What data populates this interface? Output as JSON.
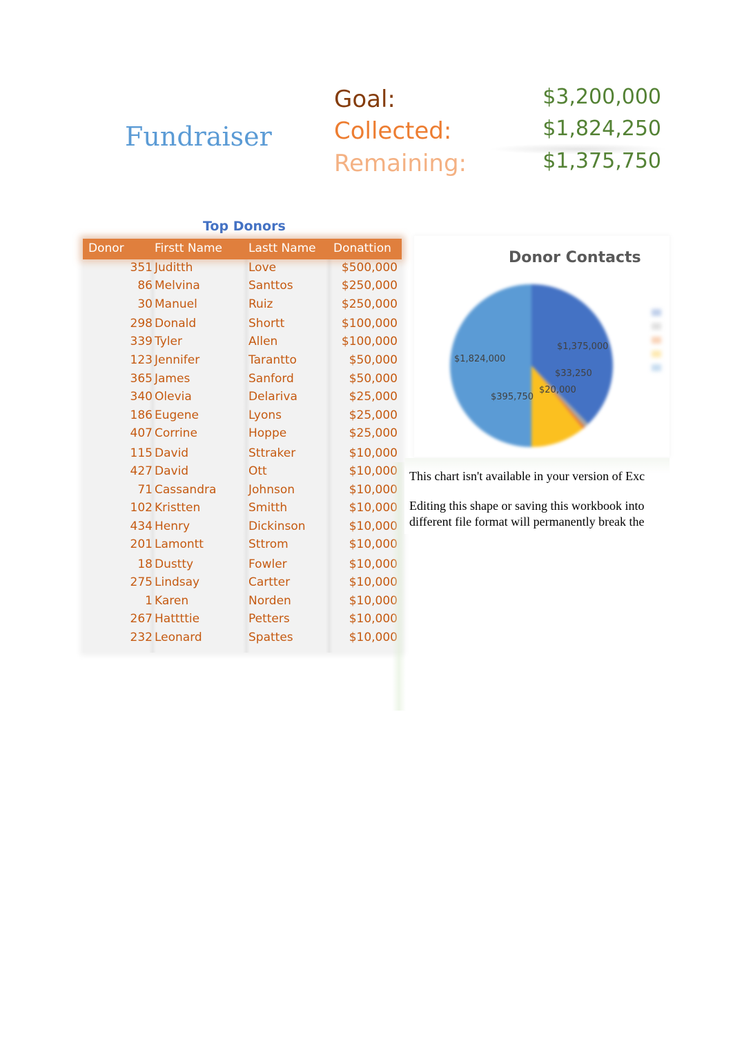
{
  "header": {
    "title": "Fundraiser",
    "summary": [
      {
        "label": "Goal:",
        "value": "$3,200,000"
      },
      {
        "label": "Collected:",
        "value": "$1,824,250"
      },
      {
        "label": "Remaining:",
        "value": "$1,375,750"
      }
    ]
  },
  "colors": {
    "title": "#5b9bd5",
    "goal_label": "#843c0c",
    "collected_label": "#ed7d31",
    "remaining_label": "#f4b183",
    "amount": "#548235",
    "table_header": "#e07f3d",
    "table_text": "#c55a11",
    "table_title": "#4472c4"
  },
  "table": {
    "title": "Top Donors",
    "columns": [
      "Donor",
      "Firstt Name",
      "Lastt Name",
      "Donattion"
    ],
    "rows": [
      {
        "id": "351",
        "first": "Juditth",
        "last": "Love",
        "donation": "$500,000"
      },
      {
        "id": "86",
        "first": "Melvina",
        "last": "Santtos",
        "donation": "$250,000"
      },
      {
        "id": "30",
        "first": "Manuel",
        "last": "Ruiz",
        "donation": "$250,000"
      },
      {
        "id": "298",
        "first": "Donald",
        "last": "Shortt",
        "donation": "$100,000"
      },
      {
        "id": "339",
        "first": "Tyler",
        "last": "Allen",
        "donation": "$100,000"
      },
      {
        "id": "123",
        "first": "Jennifer",
        "last": "Tarantto",
        "donation": "$50,000"
      },
      {
        "id": "365",
        "first": "James",
        "last": "Sanford",
        "donation": "$50,000"
      },
      {
        "id": "340",
        "first": "Olevia",
        "last": "Delariva",
        "donation": "$25,000"
      },
      {
        "id": "186",
        "first": "Eugene",
        "last": "Lyons",
        "donation": "$25,000"
      },
      {
        "id": "407",
        "first": "Corrine",
        "last": "Hoppe",
        "donation": "$25,000"
      },
      {
        "id": "115",
        "first": "David",
        "last": "Sttraker",
        "donation": "$10,000"
      },
      {
        "id": "427",
        "first": "David",
        "last": "Ott",
        "donation": "$10,000"
      },
      {
        "id": "71",
        "first": "Cassandra",
        "last": "Johnson",
        "donation": "$10,000"
      },
      {
        "id": "102",
        "first": "Kristten",
        "last": "Smitth",
        "donation": "$10,000"
      },
      {
        "id": "434",
        "first": "Henry",
        "last": "Dickinson",
        "donation": "$10,000"
      },
      {
        "id": "201",
        "first": "Lamontt",
        "last": "Sttrom",
        "donation": "$10,000"
      },
      {
        "id": "18",
        "first": "Dustty",
        "last": "Fowler",
        "donation": "$10,000"
      },
      {
        "id": "275",
        "first": "Lindsay",
        "last": "Cartter",
        "donation": "$10,000"
      },
      {
        "id": "1",
        "first": "Karen",
        "last": "Norden",
        "donation": "$10,000"
      },
      {
        "id": "267",
        "first": "Hattttie",
        "last": "Petters",
        "donation": "$10,000"
      },
      {
        "id": "232",
        "first": "Leonard",
        "last": "Spattes",
        "donation": "$10,000"
      }
    ]
  },
  "chart_data": {
    "type": "pie",
    "title": "Donor Contacts",
    "slices": [
      {
        "label": "$1,375,000",
        "value": 1375000,
        "color": "#4472c4"
      },
      {
        "label": "$33,250",
        "value": 33250,
        "color": "#a5a5a5"
      },
      {
        "label": "$20,000",
        "value": 20000,
        "color": "#ed7d31"
      },
      {
        "label": "$395,750",
        "value": 395750,
        "color": "#fbc020"
      },
      {
        "label": "$1,824,000",
        "value": 1824000,
        "color": "#5b9bd5"
      }
    ],
    "legend_position": "right"
  },
  "notice": {
    "line1": "This chart isn't available in your version of Exc",
    "line2": "Editing this shape or saving this workbook into",
    "line3": "different file format will permanently break the"
  }
}
